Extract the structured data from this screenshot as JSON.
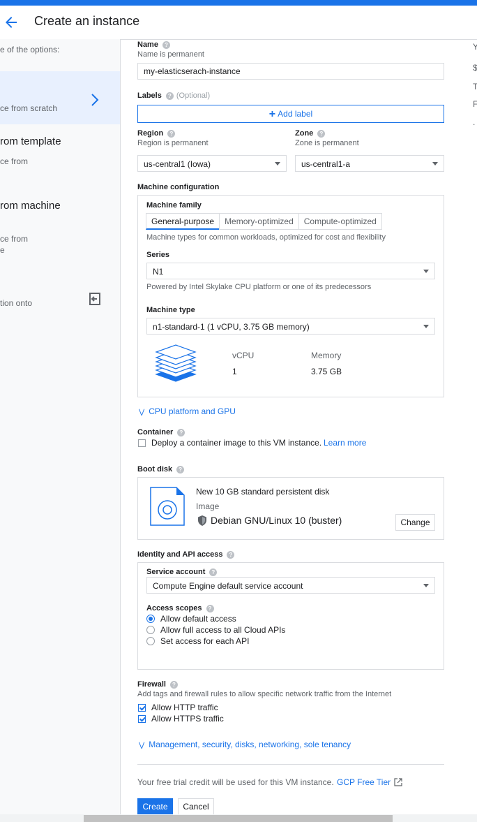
{
  "header": {
    "title": "Create an instance"
  },
  "left_panel": {
    "intro": "e of the options:",
    "options": [
      {
        "title": "",
        "desc": "ce from scratch",
        "selected": true
      },
      {
        "title": "rom template",
        "desc": "ce from"
      },
      {
        "title": "rom machine",
        "desc1": "ce from",
        "desc2": "e"
      },
      {
        "desc": "tion onto"
      }
    ]
  },
  "right_peek": [
    "Y",
    "$",
    "T",
    "F",
    "."
  ],
  "form": {
    "name": {
      "label": "Name",
      "sublabel": "Name is permanent",
      "value": "my-elasticserach-instance"
    },
    "labels": {
      "label": "Labels",
      "optional": "(Optional)",
      "add_button": "Add label"
    },
    "region": {
      "label": "Region",
      "sublabel": "Region is permanent",
      "value": "us-central1 (Iowa)"
    },
    "zone": {
      "label": "Zone",
      "sublabel": "Zone is permanent",
      "value": "us-central1-a"
    },
    "machine_config": {
      "label": "Machine configuration",
      "family_label": "Machine family",
      "families": [
        "General-purpose",
        "Memory-optimized",
        "Compute-optimized"
      ],
      "family_desc": "Machine types for common workloads, optimized for cost and flexibility",
      "series_label": "Series",
      "series_value": "N1",
      "series_desc": "Powered by Intel Skylake CPU platform or one of its predecessors",
      "type_label": "Machine type",
      "type_value": "n1-standard-1 (1 vCPU, 3.75 GB memory)",
      "vcpu_label": "vCPU",
      "vcpu_value": "1",
      "memory_label": "Memory",
      "memory_value": "3.75 GB"
    },
    "cpu_platform_link": "CPU platform and GPU",
    "container": {
      "label": "Container",
      "checkbox_text": "Deploy a container image to this VM instance.",
      "learn_more": "Learn more"
    },
    "boot_disk": {
      "label": "Boot disk",
      "title": "New 10 GB standard persistent disk",
      "image_label": "Image",
      "image_value": "Debian GNU/Linux 10 (buster)",
      "change_button": "Change"
    },
    "identity": {
      "label": "Identity and API access",
      "service_account_label": "Service account",
      "service_account_value": "Compute Engine default service account",
      "access_scopes_label": "Access scopes",
      "scopes": [
        "Allow default access",
        "Allow full access to all Cloud APIs",
        "Set access for each API"
      ]
    },
    "firewall": {
      "label": "Firewall",
      "desc": "Add tags and firewall rules to allow specific network traffic from the Internet",
      "http": "Allow HTTP traffic",
      "https": "Allow HTTPS traffic"
    },
    "management_link": "Management, security, disks, networking, sole tenancy",
    "free_trial_text": "Your free trial credit will be used for this VM instance.",
    "free_tier_link": "GCP Free Tier",
    "create_button": "Create",
    "cancel_button": "Cancel"
  },
  "colors": {
    "accent": "#1a73e8",
    "border": "#dadce0",
    "muted": "#5f6368"
  }
}
